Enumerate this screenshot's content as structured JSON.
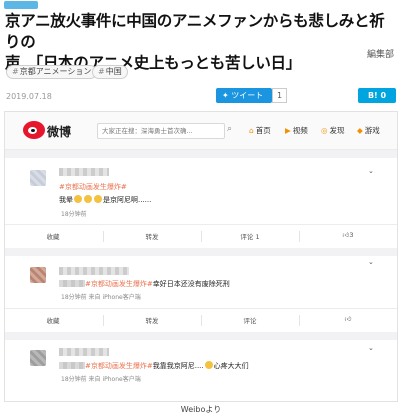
{
  "article": {
    "chip": "",
    "title_line1": "京アニ放火事件に中国のアニメファンからも悲しみと祈りの",
    "title_line2": "声　「日本のアニメ史上もっとも苦しい日」",
    "department": "編集部",
    "tags": [
      "京都アニメーション",
      "中国"
    ],
    "date": "2019.07.18",
    "tweet_label": "ツイート",
    "tweet_count": "1",
    "bookmark_label": "B!",
    "bookmark_count": "0",
    "caption": "Weiboより"
  },
  "weibo": {
    "logo_text": "微博",
    "search_placeholder": "大家正在搜：深海勇士首次确...",
    "nav": [
      {
        "icon": "home-icon",
        "label": "首页"
      },
      {
        "icon": "video-icon",
        "label": "视频"
      },
      {
        "icon": "discover-icon",
        "label": "发现"
      },
      {
        "icon": "game-icon",
        "label": "游戏"
      }
    ],
    "posts": [
      {
        "text_prefix": "#京都动画发生爆炸#",
        "text_body": "我晕",
        "text_tail": "是京阿尼啊......",
        "meta": "18分钟前",
        "actions": [
          "收藏",
          "转发",
          "评论 1",
          "3"
        ]
      },
      {
        "text_prefix": "#京都动画发生爆炸#",
        "text_body": "幸好日本还没有废除死刑",
        "meta": "18分钟前  来自 iPhone客户端",
        "actions": [
          "收藏",
          "转发",
          "评论",
          ""
        ]
      },
      {
        "text_prefix": "#京都动画发生爆炸#",
        "text_body": "我靠我京阿尼....",
        "text_tail": "心疼大大们",
        "meta": "18分钟前  来自 iPhone客户端"
      }
    ]
  }
}
